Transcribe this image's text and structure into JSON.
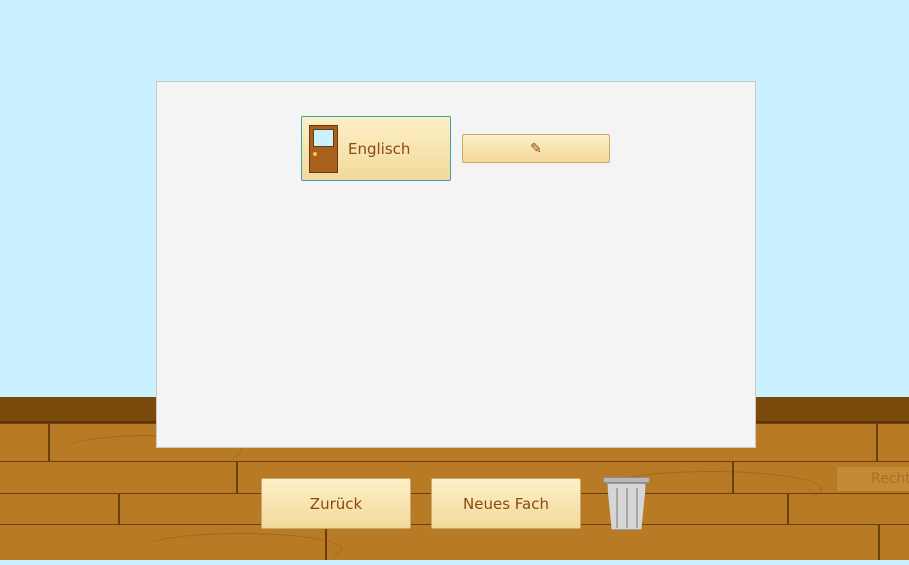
{
  "subject": {
    "name": "Englisch",
    "icon": "door-icon"
  },
  "edit_button": {
    "label": "✎",
    "icon": "pencil-icon"
  },
  "footer": {
    "back_label": "Zurück",
    "new_subject_label": "Neues Fach",
    "trash_icon": "trash-can-icon"
  },
  "right_edge_label": "Recht",
  "colors": {
    "sky": "#c9f1ff",
    "floor": "#b87a24",
    "panel": "#f4f4f4",
    "button_text": "#8a4a10",
    "selected_border": "#3aa0a8"
  }
}
